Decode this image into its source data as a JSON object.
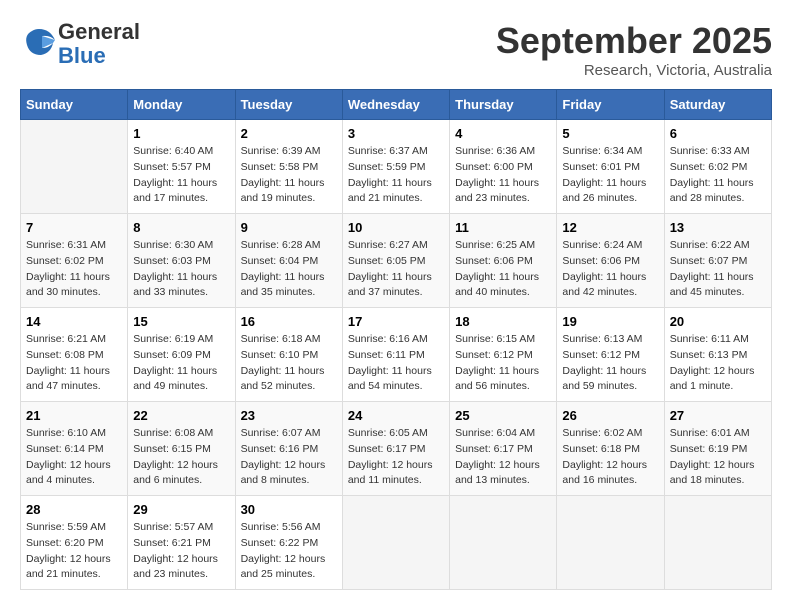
{
  "logo": {
    "line1": "General",
    "line2": "Blue"
  },
  "title": "September 2025",
  "subtitle": "Research, Victoria, Australia",
  "days_header": [
    "Sunday",
    "Monday",
    "Tuesday",
    "Wednesday",
    "Thursday",
    "Friday",
    "Saturday"
  ],
  "weeks": [
    [
      {
        "day": "",
        "info": ""
      },
      {
        "day": "1",
        "info": "Sunrise: 6:40 AM\nSunset: 5:57 PM\nDaylight: 11 hours\nand 17 minutes."
      },
      {
        "day": "2",
        "info": "Sunrise: 6:39 AM\nSunset: 5:58 PM\nDaylight: 11 hours\nand 19 minutes."
      },
      {
        "day": "3",
        "info": "Sunrise: 6:37 AM\nSunset: 5:59 PM\nDaylight: 11 hours\nand 21 minutes."
      },
      {
        "day": "4",
        "info": "Sunrise: 6:36 AM\nSunset: 6:00 PM\nDaylight: 11 hours\nand 23 minutes."
      },
      {
        "day": "5",
        "info": "Sunrise: 6:34 AM\nSunset: 6:01 PM\nDaylight: 11 hours\nand 26 minutes."
      },
      {
        "day": "6",
        "info": "Sunrise: 6:33 AM\nSunset: 6:02 PM\nDaylight: 11 hours\nand 28 minutes."
      }
    ],
    [
      {
        "day": "7",
        "info": "Sunrise: 6:31 AM\nSunset: 6:02 PM\nDaylight: 11 hours\nand 30 minutes."
      },
      {
        "day": "8",
        "info": "Sunrise: 6:30 AM\nSunset: 6:03 PM\nDaylight: 11 hours\nand 33 minutes."
      },
      {
        "day": "9",
        "info": "Sunrise: 6:28 AM\nSunset: 6:04 PM\nDaylight: 11 hours\nand 35 minutes."
      },
      {
        "day": "10",
        "info": "Sunrise: 6:27 AM\nSunset: 6:05 PM\nDaylight: 11 hours\nand 37 minutes."
      },
      {
        "day": "11",
        "info": "Sunrise: 6:25 AM\nSunset: 6:06 PM\nDaylight: 11 hours\nand 40 minutes."
      },
      {
        "day": "12",
        "info": "Sunrise: 6:24 AM\nSunset: 6:06 PM\nDaylight: 11 hours\nand 42 minutes."
      },
      {
        "day": "13",
        "info": "Sunrise: 6:22 AM\nSunset: 6:07 PM\nDaylight: 11 hours\nand 45 minutes."
      }
    ],
    [
      {
        "day": "14",
        "info": "Sunrise: 6:21 AM\nSunset: 6:08 PM\nDaylight: 11 hours\nand 47 minutes."
      },
      {
        "day": "15",
        "info": "Sunrise: 6:19 AM\nSunset: 6:09 PM\nDaylight: 11 hours\nand 49 minutes."
      },
      {
        "day": "16",
        "info": "Sunrise: 6:18 AM\nSunset: 6:10 PM\nDaylight: 11 hours\nand 52 minutes."
      },
      {
        "day": "17",
        "info": "Sunrise: 6:16 AM\nSunset: 6:11 PM\nDaylight: 11 hours\nand 54 minutes."
      },
      {
        "day": "18",
        "info": "Sunrise: 6:15 AM\nSunset: 6:12 PM\nDaylight: 11 hours\nand 56 minutes."
      },
      {
        "day": "19",
        "info": "Sunrise: 6:13 AM\nSunset: 6:12 PM\nDaylight: 11 hours\nand 59 minutes."
      },
      {
        "day": "20",
        "info": "Sunrise: 6:11 AM\nSunset: 6:13 PM\nDaylight: 12 hours\nand 1 minute."
      }
    ],
    [
      {
        "day": "21",
        "info": "Sunrise: 6:10 AM\nSunset: 6:14 PM\nDaylight: 12 hours\nand 4 minutes."
      },
      {
        "day": "22",
        "info": "Sunrise: 6:08 AM\nSunset: 6:15 PM\nDaylight: 12 hours\nand 6 minutes."
      },
      {
        "day": "23",
        "info": "Sunrise: 6:07 AM\nSunset: 6:16 PM\nDaylight: 12 hours\nand 8 minutes."
      },
      {
        "day": "24",
        "info": "Sunrise: 6:05 AM\nSunset: 6:17 PM\nDaylight: 12 hours\nand 11 minutes."
      },
      {
        "day": "25",
        "info": "Sunrise: 6:04 AM\nSunset: 6:17 PM\nDaylight: 12 hours\nand 13 minutes."
      },
      {
        "day": "26",
        "info": "Sunrise: 6:02 AM\nSunset: 6:18 PM\nDaylight: 12 hours\nand 16 minutes."
      },
      {
        "day": "27",
        "info": "Sunrise: 6:01 AM\nSunset: 6:19 PM\nDaylight: 12 hours\nand 18 minutes."
      }
    ],
    [
      {
        "day": "28",
        "info": "Sunrise: 5:59 AM\nSunset: 6:20 PM\nDaylight: 12 hours\nand 21 minutes."
      },
      {
        "day": "29",
        "info": "Sunrise: 5:57 AM\nSunset: 6:21 PM\nDaylight: 12 hours\nand 23 minutes."
      },
      {
        "day": "30",
        "info": "Sunrise: 5:56 AM\nSunset: 6:22 PM\nDaylight: 12 hours\nand 25 minutes."
      },
      {
        "day": "",
        "info": ""
      },
      {
        "day": "",
        "info": ""
      },
      {
        "day": "",
        "info": ""
      },
      {
        "day": "",
        "info": ""
      }
    ]
  ]
}
